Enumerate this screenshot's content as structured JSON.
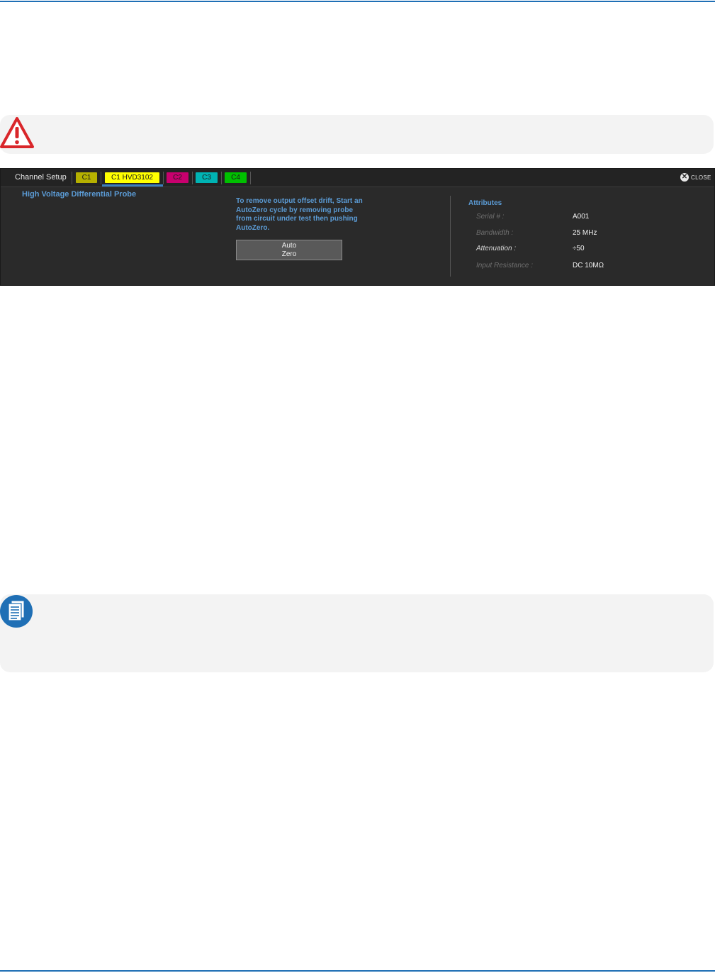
{
  "colors": {
    "rule": "#1f6fb5",
    "accent_blue": "#5b9bd5",
    "chip_c1": "#b5b000",
    "chip_c1_active": "#ffff00",
    "chip_c2": "#c8006e",
    "chip_c3": "#00b4b4",
    "chip_c4": "#00c000"
  },
  "tabs": {
    "title": "Channel Setup",
    "chips": [
      {
        "label": "C1"
      },
      {
        "label": "C1 HVD3102",
        "active": true
      },
      {
        "label": "C2"
      },
      {
        "label": "C3"
      },
      {
        "label": "C4"
      }
    ],
    "close_label": "CLOSE"
  },
  "panel": {
    "probe_title": "High Voltage Differential Probe",
    "instructions": "To remove output offset drift, Start an\nAutoZero cycle by removing probe\n from circuit under test then pushing\nAutoZero.",
    "autozero_button": "Auto\nZero"
  },
  "attributes": {
    "title": "Attributes",
    "rows": [
      {
        "label": "Serial # :",
        "value": "A001"
      },
      {
        "label": "Bandwidth :",
        "value": "25 MHz"
      },
      {
        "label": "Attenuation :",
        "value": "÷50"
      },
      {
        "label": "Input Resistance :",
        "value": "DC 10MΩ"
      }
    ]
  },
  "icons": {
    "warning": "warning-triangle-icon",
    "note": "note-document-icon",
    "close": "close-circle-icon"
  }
}
